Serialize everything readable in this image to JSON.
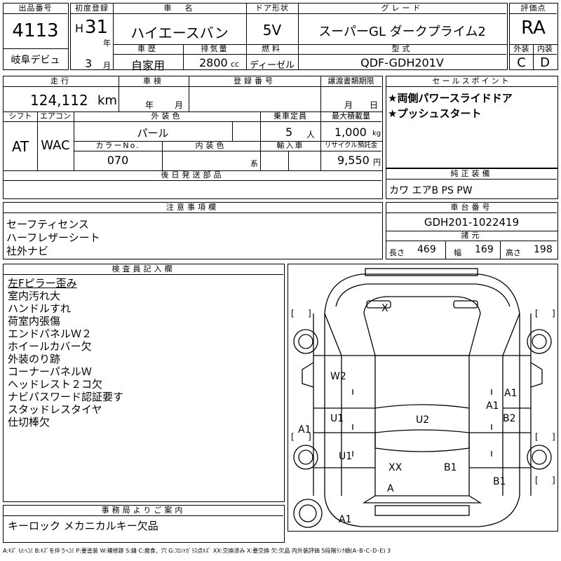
{
  "header": {
    "lot_label": "出品番号",
    "lot_number": "4113",
    "debut_label": "岐阜デビュ",
    "first_reg_label": "初度登録",
    "era": "H",
    "reg_year": "31",
    "year_unit": "年",
    "reg_month": "3",
    "month_unit": "月",
    "car_name_label": "車　名",
    "car_name": "ハイエースバン",
    "door_label": "ドア形状",
    "door_value": "5V",
    "grade_label": "グレード",
    "grade_value": "スーパーGL ダークプライム2",
    "score_label": "評価点",
    "score_value": "RA",
    "history_label": "車歴",
    "history_value": "自家用",
    "displacement_label": "排気量",
    "displacement_value": "2800",
    "displacement_unit": "cc",
    "fuel_label": "燃料",
    "fuel_value": "ディーゼル",
    "model_label": "型式",
    "model_value": "QDF-GDH201V",
    "exterior_label": "外装",
    "exterior_value": "C",
    "interior_label": "内装",
    "interior_value": "D"
  },
  "row2": {
    "mileage_label": "走行",
    "mileage_value": "124,112",
    "mileage_unit": "km",
    "inspection_label": "車検",
    "inspection_year_unit": "年",
    "inspection_month_unit": "月",
    "reg_number_label": "登録番号",
    "transfer_label": "譲渡書類期限",
    "transfer_month_unit": "月",
    "transfer_day_unit": "日",
    "shift_label": "シフト",
    "shift_value": "AT",
    "ac_label": "エアコン",
    "ac_value": "WAC",
    "ext_color_label": "外装色",
    "ext_color_value": "パール",
    "capacity_label": "乗車定員",
    "capacity_value": "5",
    "capacity_unit": "人",
    "max_load_label": "最大積載量",
    "max_load_value": "1,000",
    "max_load_unit": "kg",
    "color_no_label": "カラーNo.",
    "color_no_value": "070",
    "int_color_label": "内装色",
    "int_color_unit": "系",
    "import_label": "輸入車",
    "recycle_label": "リサイクル預託金",
    "recycle_value": "9,550",
    "recycle_unit": "円",
    "later_parts_label": "後日発送部品"
  },
  "selling_points": {
    "label": "セールスポイント",
    "items": [
      "★両側パワースライドドア",
      "★プッシュスタート"
    ]
  },
  "equipment": {
    "label": "純正装備",
    "value": "カワ エアB PS PW"
  },
  "notes": {
    "label": "注意事項欄",
    "items": [
      "セーフティセンス",
      "ハーフレザーシート",
      "社外ナビ"
    ]
  },
  "chassis": {
    "label": "車台番号",
    "value": "GDH201-1022419",
    "spec_label": "諸元",
    "length_label": "長さ",
    "length_value": "469",
    "width_label": "幅",
    "width_value": "169",
    "height_label": "高さ",
    "height_value": "198"
  },
  "inspector": {
    "label": "検査員記入欄",
    "items": [
      "左Fピラー歪み",
      "室内汚れ大",
      "ハンドルすれ",
      "荷室内張傷",
      "エンドパネルＷ２",
      "ホイールカバー欠",
      "外装のり跡",
      "コーナーパネルＷ",
      "ヘッドレスト２コ欠",
      "ナビパスワード認証要す",
      "スタッドレスタイヤ",
      "仕切棒欠"
    ]
  },
  "diagram": {
    "marks": [
      "X",
      "W2",
      "A1",
      "A1",
      "U1",
      "U2",
      "B2",
      "A1",
      "U1",
      "XX",
      "B1",
      "B1",
      "A",
      "A1"
    ]
  },
  "office": {
    "label": "事務局よりご案内",
    "value": "キーロック メカニカルキー欠品"
  },
  "legend": "A:ｷｽﾞ U:ﾍｺﾐ B:ｷｽﾞを伴うﾍｺﾐ P:要塗装 W:補修跡 S:錆 C:腐食、穴 G:ﾌﾛﾝﾄｶﾞﾗｽ点ｷｽﾞ XX:交換済み X:要交換 欠:欠品 内外装評価 5段階ﾗﾝｸ順(A･B･C･D･E) 3"
}
